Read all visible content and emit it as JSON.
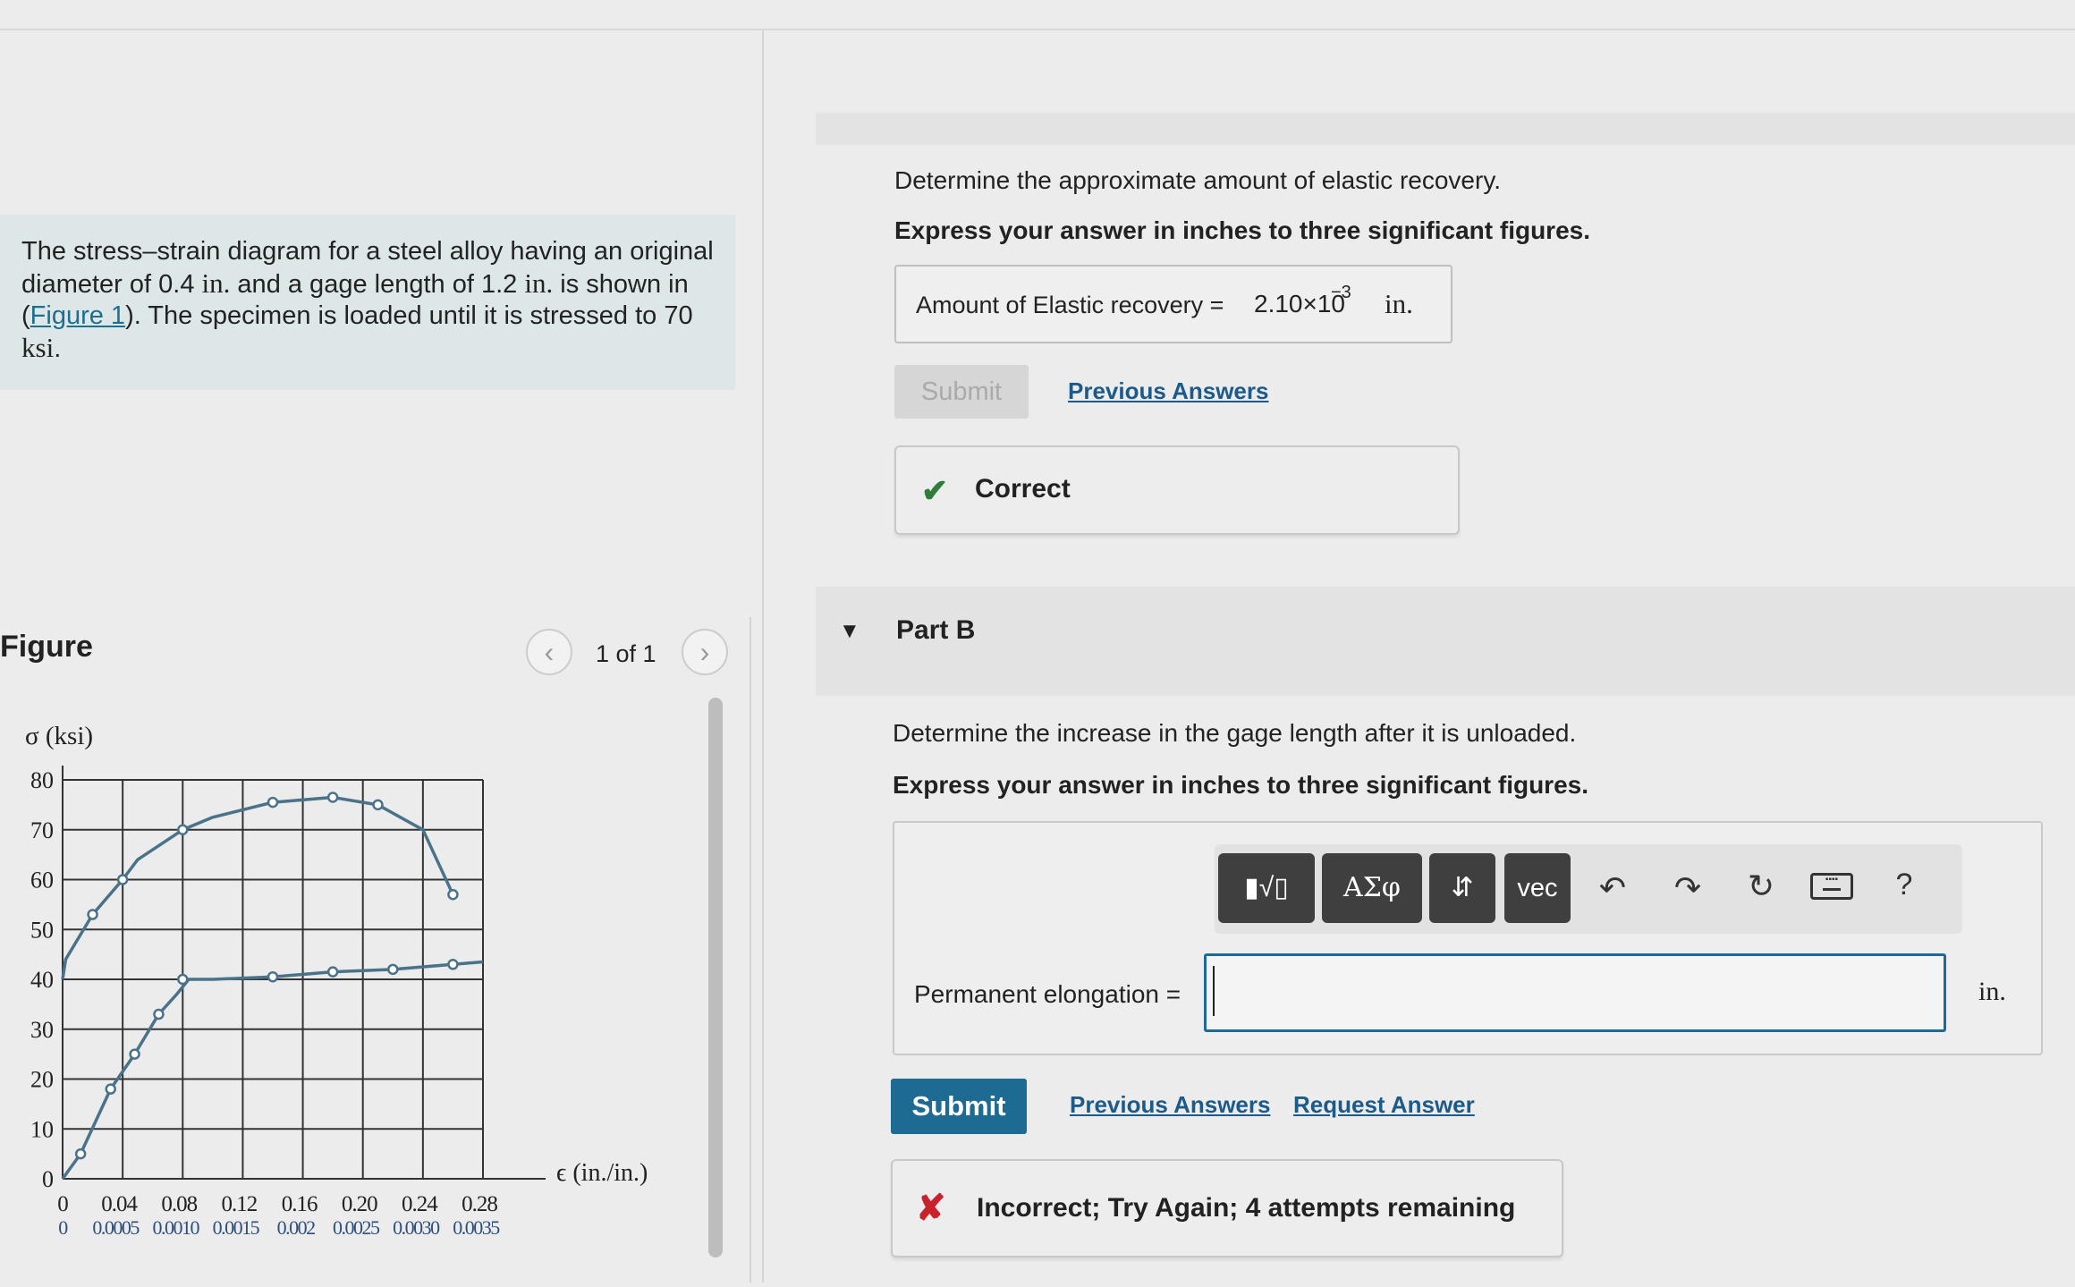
{
  "problem": {
    "text_1": "The stress–strain diagram for a steel alloy having an original diameter of 0.4 ",
    "unit_in": "in.",
    "text_2": " and a gage length of 1.2 ",
    "text_3": " is shown in (",
    "figure_link": "Figure 1",
    "text_4": "). The specimen is loaded until it is stressed to 70 ",
    "unit_ksi": "ksi",
    "text_5": "."
  },
  "figure": {
    "label": "Figure",
    "page_indicator": "1 of 1",
    "prev_icon": "chevron-left-icon",
    "next_icon": "chevron-right-icon"
  },
  "chart_data": {
    "type": "line",
    "ylabel": "σ (ksi)",
    "xlabel": "ϵ (in./in.)",
    "y_ticks": [
      "0",
      "10",
      "20",
      "30",
      "40",
      "50",
      "60",
      "70",
      "80"
    ],
    "x_ticks_top": [
      "0",
      "0.04",
      "0.08",
      "0.12",
      "0.16",
      "0.20",
      "0.24",
      "0.28"
    ],
    "x_ticks_bottom": [
      "0",
      "0.0005",
      "0.0010",
      "0.0015",
      "0.002",
      "0.0025",
      "0.0030",
      "0.0035"
    ],
    "ylim": [
      0,
      80
    ],
    "xlim_top": [
      0,
      0.28
    ],
    "xlim_bottom": [
      0,
      0.0035
    ],
    "grid": true,
    "series": [
      {
        "axis": "top",
        "x": [
          0,
          0.002,
          0.01,
          0.02,
          0.04,
          0.05,
          0.08,
          0.1,
          0.14,
          0.18,
          0.21,
          0.24,
          0.26
        ],
        "y": [
          40,
          44,
          48,
          53,
          60,
          64,
          70,
          72.5,
          75.5,
          76.5,
          75,
          70,
          57
        ]
      },
      {
        "axis": "top",
        "x": [
          0.08,
          0.1,
          0.14,
          0.18,
          0.22,
          0.26,
          0.28
        ],
        "y": [
          40,
          40,
          40.5,
          41.5,
          42,
          43,
          43.5
        ]
      },
      {
        "axis": "bottom",
        "x": [
          0,
          0.00015,
          0.0004,
          0.0006,
          0.0008,
          0.00095,
          0.00105
        ],
        "y": [
          0,
          5,
          18,
          25,
          33,
          37,
          40
        ]
      }
    ],
    "markers_top_curve": [
      [
        0.02,
        53
      ],
      [
        0.04,
        60
      ],
      [
        0.08,
        70
      ],
      [
        0.14,
        75.5
      ],
      [
        0.18,
        76.5
      ],
      [
        0.21,
        75
      ],
      [
        0.26,
        57
      ]
    ],
    "markers_flat": [
      [
        0.08,
        40
      ],
      [
        0.14,
        40.5
      ],
      [
        0.18,
        41.5
      ],
      [
        0.22,
        42
      ],
      [
        0.26,
        43
      ]
    ],
    "markers_bottom": [
      [
        0.00015,
        5
      ],
      [
        0.0004,
        18
      ],
      [
        0.0006,
        25
      ],
      [
        0.0008,
        33
      ]
    ]
  },
  "part_a": {
    "question": "Determine the approximate amount of elastic recovery.",
    "instruction": "Express your answer in inches to three significant figures.",
    "answer_label": "Amount of Elastic recovery =",
    "answer_value": "2.10×10",
    "answer_exponent": "−3",
    "answer_unit": "in.",
    "submit_label": "Submit",
    "previous_answers": "Previous Answers",
    "feedback": "Correct",
    "feedback_icon": "checkmark-icon"
  },
  "part_b": {
    "title": "Part B",
    "toggle_icon": "caret-down-icon",
    "question": "Determine the increase in the gage length after it is unloaded.",
    "instruction": "Express your answer in inches to three significant figures.",
    "toolbar": {
      "templates": "▮√▯",
      "greek": "ΑΣφ",
      "arrows": "⇵",
      "vec": "vec",
      "undo_icon": "undo-icon",
      "redo_icon": "redo-icon",
      "reset_icon": "reset-icon",
      "keyboard_icon": "keyboard-icon",
      "help": "?"
    },
    "input_label": "Permanent elongation =",
    "input_value": "",
    "input_unit": "in.",
    "submit_label": "Submit",
    "previous_answers": "Previous Answers",
    "request_answer": "Request Answer",
    "feedback": "Incorrect; Try Again; 4 attempts remaining",
    "feedback_icon": "x-icon"
  }
}
